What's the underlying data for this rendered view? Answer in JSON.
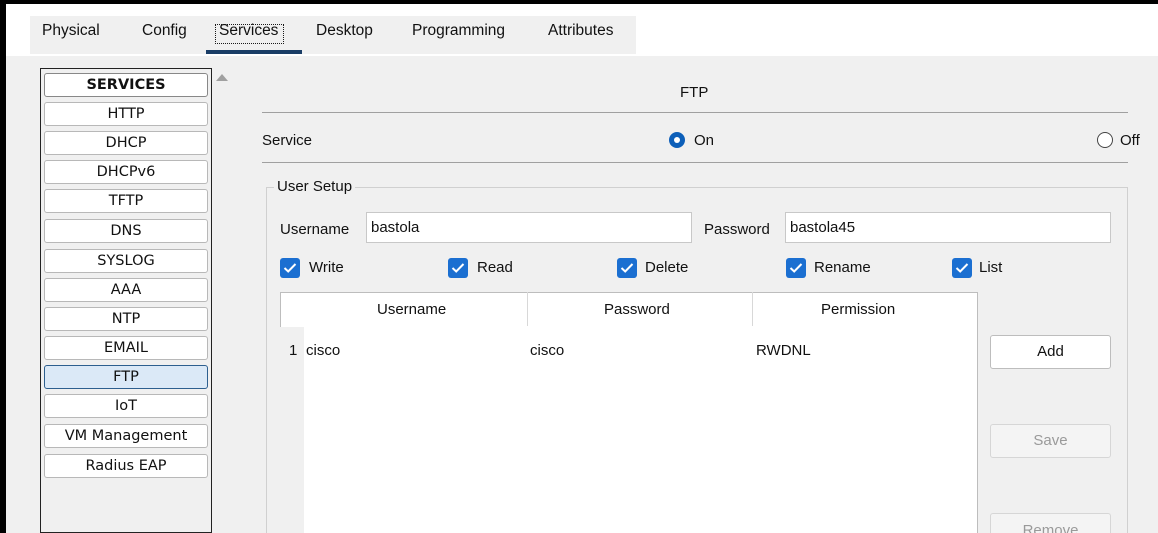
{
  "tabs": [
    {
      "label": "Physical"
    },
    {
      "label": "Config"
    },
    {
      "label": "Services",
      "selected": true
    },
    {
      "label": "Desktop"
    },
    {
      "label": "Programming"
    },
    {
      "label": "Attributes"
    }
  ],
  "sidebar": {
    "header": "SERVICES",
    "items": [
      "HTTP",
      "DHCP",
      "DHCPv6",
      "TFTP",
      "DNS",
      "SYSLOG",
      "AAA",
      "NTP",
      "EMAIL",
      "FTP",
      "IoT",
      "VM Management",
      "Radius EAP"
    ],
    "selected": "FTP"
  },
  "ftp": {
    "title": "FTP",
    "service_label": "Service",
    "on_label": "On",
    "off_label": "Off",
    "service_state": "On"
  },
  "user_setup": {
    "title": "User Setup",
    "username_label": "Username",
    "username_value": "bastola",
    "password_label": "Password",
    "password_value": "bastola45",
    "permissions": [
      {
        "label": "Write",
        "checked": true
      },
      {
        "label": "Read",
        "checked": true
      },
      {
        "label": "Delete",
        "checked": true
      },
      {
        "label": "Rename",
        "checked": true
      },
      {
        "label": "List",
        "checked": true
      }
    ]
  },
  "table": {
    "columns": [
      "Username",
      "Password",
      "Permission"
    ],
    "rows": [
      {
        "index": "1",
        "username": "cisco",
        "password": "cisco",
        "permission": "RWDNL"
      }
    ]
  },
  "buttons": {
    "add": "Add",
    "save": "Save",
    "remove": "Remove"
  },
  "colors": {
    "accent": "#1b6fd1",
    "tab_underline": "#1a3d66",
    "selected_item": "#dbe9f7"
  }
}
